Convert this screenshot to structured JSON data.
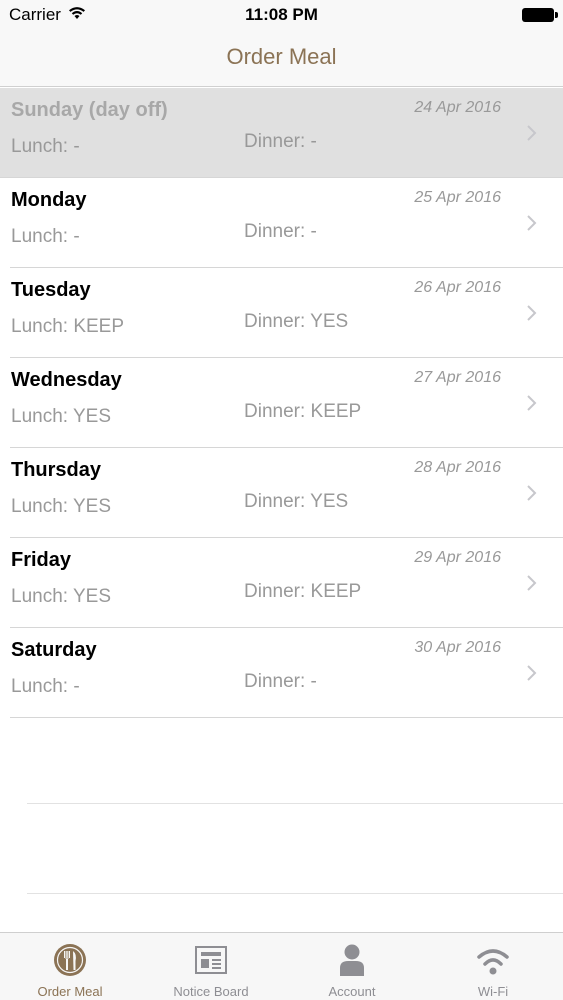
{
  "status_bar": {
    "carrier": "Carrier",
    "time": "11:08 PM"
  },
  "nav": {
    "title": "Order Meal"
  },
  "days": [
    {
      "day": "Sunday (day off)",
      "date": "24 Apr 2016",
      "lunch": "Lunch: -",
      "dinner": "Dinner: -",
      "highlighted": true
    },
    {
      "day": "Monday",
      "date": "25 Apr 2016",
      "lunch": "Lunch: -",
      "dinner": "Dinner: -"
    },
    {
      "day": "Tuesday",
      "date": "26 Apr 2016",
      "lunch": "Lunch: KEEP",
      "dinner": "Dinner: YES"
    },
    {
      "day": "Wednesday",
      "date": "27 Apr 2016",
      "lunch": "Lunch: YES",
      "dinner": "Dinner: KEEP"
    },
    {
      "day": "Thursday",
      "date": "28 Apr 2016",
      "lunch": "Lunch: YES",
      "dinner": "Dinner: YES"
    },
    {
      "day": "Friday",
      "date": "29 Apr 2016",
      "lunch": "Lunch: YES",
      "dinner": "Dinner: KEEP"
    },
    {
      "day": "Saturday",
      "date": "30 Apr 2016",
      "lunch": "Lunch: -",
      "dinner": "Dinner: -"
    }
  ],
  "tabs": [
    {
      "label": "Order Meal",
      "icon": "fork-knife-icon",
      "active": true
    },
    {
      "label": "Notice Board",
      "icon": "newspaper-icon"
    },
    {
      "label": "Account",
      "icon": "person-icon"
    },
    {
      "label": "Wi-Fi",
      "icon": "wifi-icon"
    }
  ],
  "colors": {
    "accent": "#8b7355",
    "inactive_tab": "#8e8e93",
    "secondary_text": "#999999",
    "highlight_row": "#e0e0e0"
  }
}
